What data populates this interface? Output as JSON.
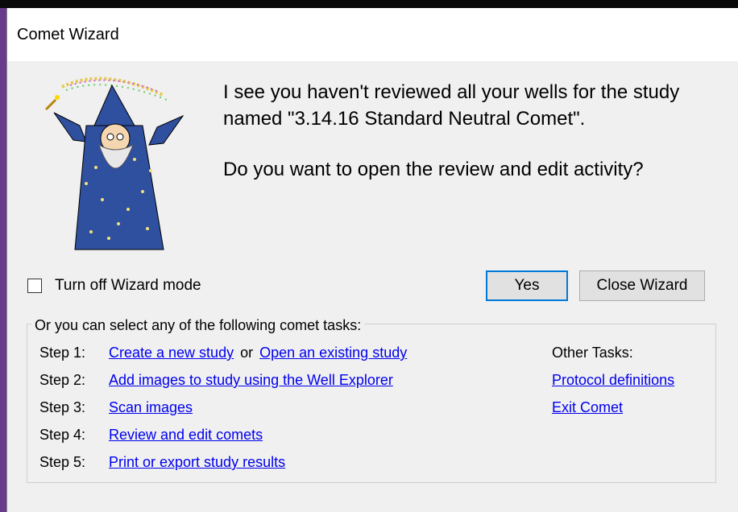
{
  "window": {
    "title": "Comet Wizard"
  },
  "message": {
    "line1": "I see you haven't reviewed all your wells for the study named \"3.14.16 Standard Neutral Comet\".",
    "line2": "Do you want to open the review and edit activity?"
  },
  "wizard_mode": {
    "label": "Turn off Wizard mode",
    "checked": false
  },
  "buttons": {
    "yes": "Yes",
    "close": "Close Wizard"
  },
  "tasks": {
    "legend": "Or you can select any of the following comet tasks:",
    "steps": [
      {
        "label": "Step 1:",
        "link1": "Create a new study",
        "sep": "or",
        "link2": "Open an existing study"
      },
      {
        "label": "Step 2:",
        "link1": "Add images to study using the Well Explorer"
      },
      {
        "label": "Step 3:",
        "link1": "Scan images"
      },
      {
        "label": "Step 4:",
        "link1": "Review and edit comets"
      },
      {
        "label": "Step 5:",
        "link1": "Print or export study results"
      }
    ],
    "other_title": "Other Tasks:",
    "other_links": [
      "Protocol definitions",
      "Exit Comet"
    ]
  },
  "icons": {
    "wizard": "wizard-illustration"
  },
  "colors": {
    "link": "#0000ee",
    "default_button_border": "#0078d7",
    "dialog_bg": "#f0f0f0"
  }
}
